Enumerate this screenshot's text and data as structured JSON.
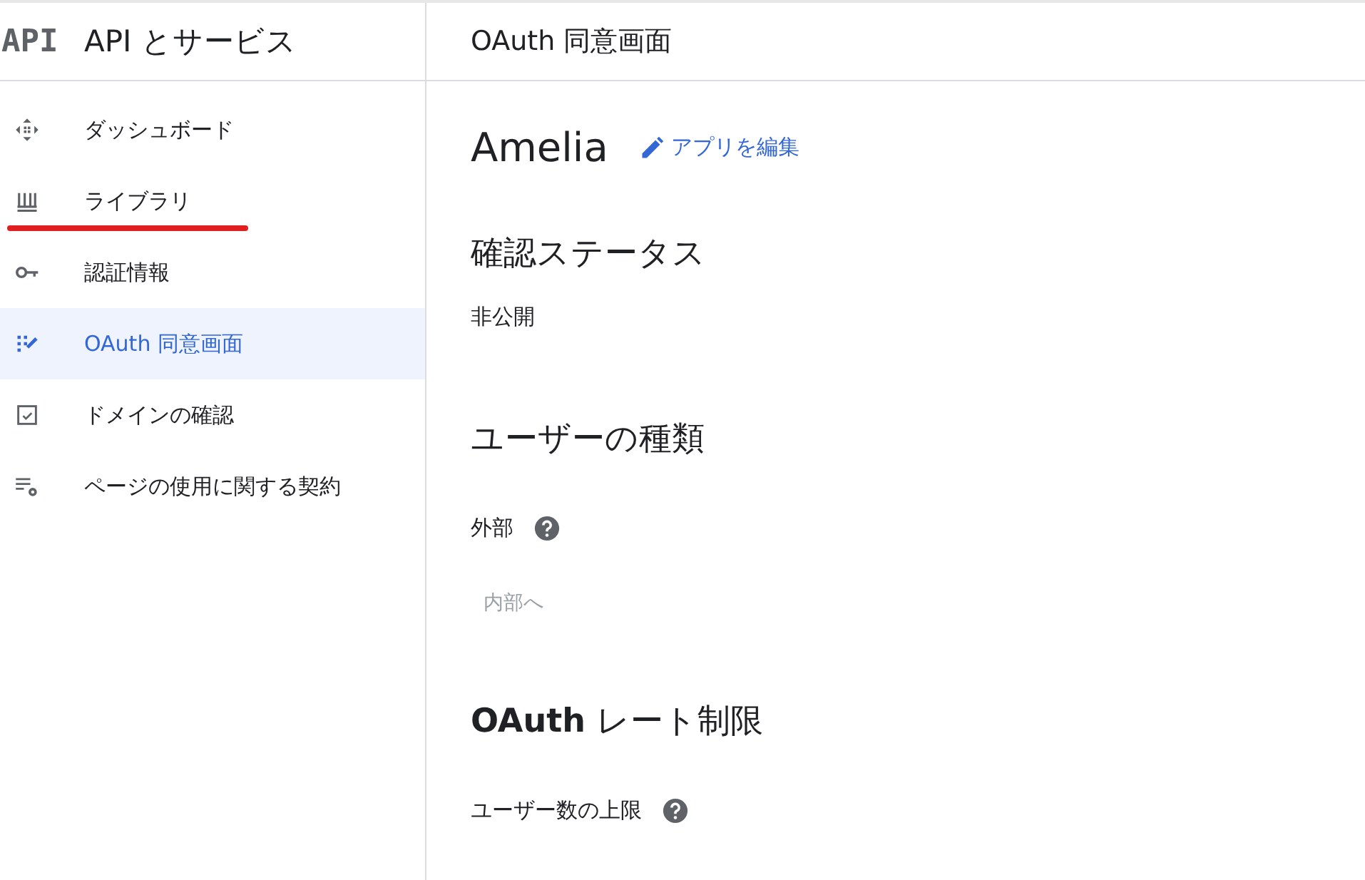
{
  "sidebar": {
    "logo": "API",
    "title": "API とサービス",
    "items": [
      {
        "label": "ダッシュボード",
        "kind": "dashboard",
        "selected": false,
        "underlined": false
      },
      {
        "label": "ライブラリ",
        "kind": "library",
        "selected": false,
        "underlined": true
      },
      {
        "label": "認証情報",
        "kind": "key",
        "selected": false,
        "underlined": false
      },
      {
        "label": "OAuth 同意画面",
        "kind": "consent",
        "selected": true,
        "underlined": false
      },
      {
        "label": "ドメインの確認",
        "kind": "domain",
        "selected": false,
        "underlined": false
      },
      {
        "label": "ページの使用に関する契約",
        "kind": "settings",
        "selected": false,
        "underlined": false
      }
    ]
  },
  "page": {
    "title": "OAuth 同意画面",
    "app_name": "Amelia",
    "edit_link": "アプリを編集",
    "blocks": [
      {
        "kind": "heading",
        "text": "確認ステータス"
      },
      {
        "kind": "value",
        "text": "非公開"
      },
      {
        "kind": "heading",
        "text": "ユーザーの種類"
      },
      {
        "kind": "help",
        "text": "外部"
      },
      {
        "kind": "button",
        "text": "内部へ",
        "disabled": true
      },
      {
        "kind": "heading",
        "text": "**OAuth** レート制限"
      },
      {
        "kind": "help",
        "text": "ユーザー数の上限"
      }
    ]
  }
}
